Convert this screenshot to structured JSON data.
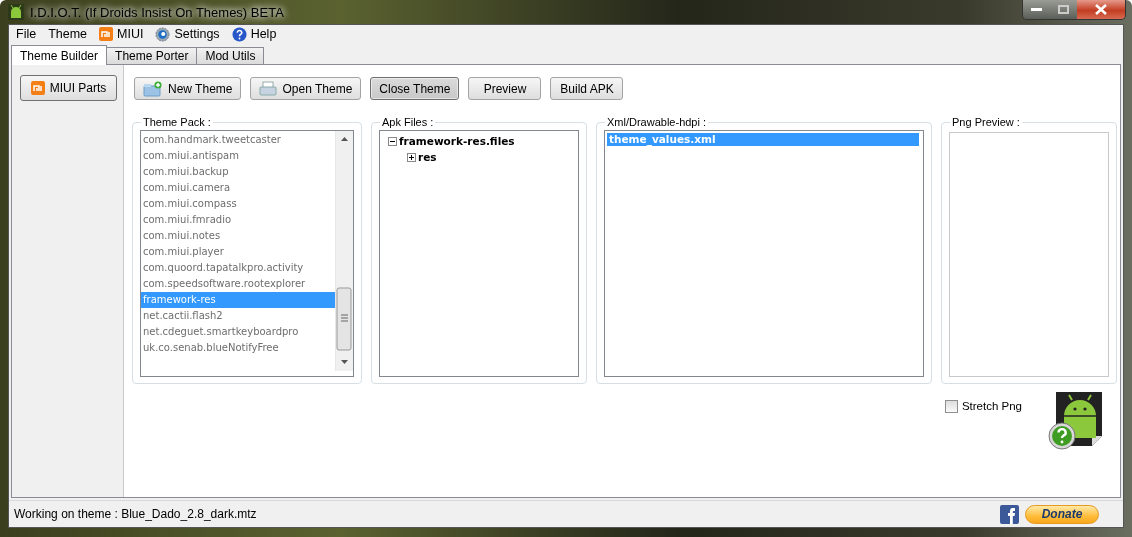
{
  "window": {
    "title": "I.D.I.O.T. (If Droids Insist On Themes) BETA"
  },
  "menu": [
    {
      "label": "File",
      "kind": "plain"
    },
    {
      "label": "Theme",
      "kind": "plain"
    },
    {
      "label": "MIUI",
      "kind": "mi"
    },
    {
      "label": "Settings",
      "kind": "gear"
    },
    {
      "label": "Help",
      "kind": "help"
    }
  ],
  "tabs": [
    {
      "label": "Theme Builder",
      "selected": true
    },
    {
      "label": "Theme Porter",
      "selected": false
    },
    {
      "label": "Mod Utils",
      "selected": false
    }
  ],
  "sidebar": {
    "items": [
      {
        "label": "MIUI Parts"
      }
    ]
  },
  "toolbar": [
    {
      "label": "New Theme",
      "kind": "new",
      "pressed": false
    },
    {
      "label": "Open Theme",
      "kind": "open",
      "pressed": false
    },
    {
      "label": "Close Theme",
      "kind": "plain",
      "pressed": true
    },
    {
      "label": "Preview",
      "kind": "plain",
      "pressed": false
    },
    {
      "label": "Build APK",
      "kind": "plain",
      "pressed": false
    }
  ],
  "theme_pack": {
    "title": "Theme Pack :",
    "items": [
      {
        "label": "com.handmark.tweetcaster",
        "selected": false
      },
      {
        "label": "com.miui.antispam",
        "selected": false
      },
      {
        "label": "com.miui.backup",
        "selected": false
      },
      {
        "label": "com.miui.camera",
        "selected": false
      },
      {
        "label": "com.miui.compass",
        "selected": false
      },
      {
        "label": "com.miui.fmradio",
        "selected": false
      },
      {
        "label": "com.miui.notes",
        "selected": false
      },
      {
        "label": "com.miui.player",
        "selected": false
      },
      {
        "label": "com.quoord.tapatalkpro.activity",
        "selected": false
      },
      {
        "label": "com.speedsoftware.rootexplorer",
        "selected": false
      },
      {
        "label": "framework-res",
        "selected": true
      },
      {
        "label": "net.cactii.flash2",
        "selected": false
      },
      {
        "label": "net.cdeguet.smartkeyboardpro",
        "selected": false
      },
      {
        "label": "uk.co.senab.blueNotifyFree",
        "selected": false
      }
    ]
  },
  "apk_files": {
    "title": "Apk Files :",
    "tree": [
      {
        "label": "framework-res.files",
        "expanded": true,
        "children": [
          {
            "label": "res",
            "expanded": false
          }
        ]
      }
    ]
  },
  "xml_files": {
    "title": "Xml/Drawable-hdpi :",
    "items": [
      {
        "label": "theme_values.xml",
        "selected": true
      }
    ]
  },
  "png_preview": {
    "title": "Png Preview :"
  },
  "stretch_png": {
    "label": "Stretch Png",
    "checked": false
  },
  "status_bar": {
    "text": "Working on theme : Blue_Dado_2.8_dark.mtz",
    "donate": "Donate"
  }
}
